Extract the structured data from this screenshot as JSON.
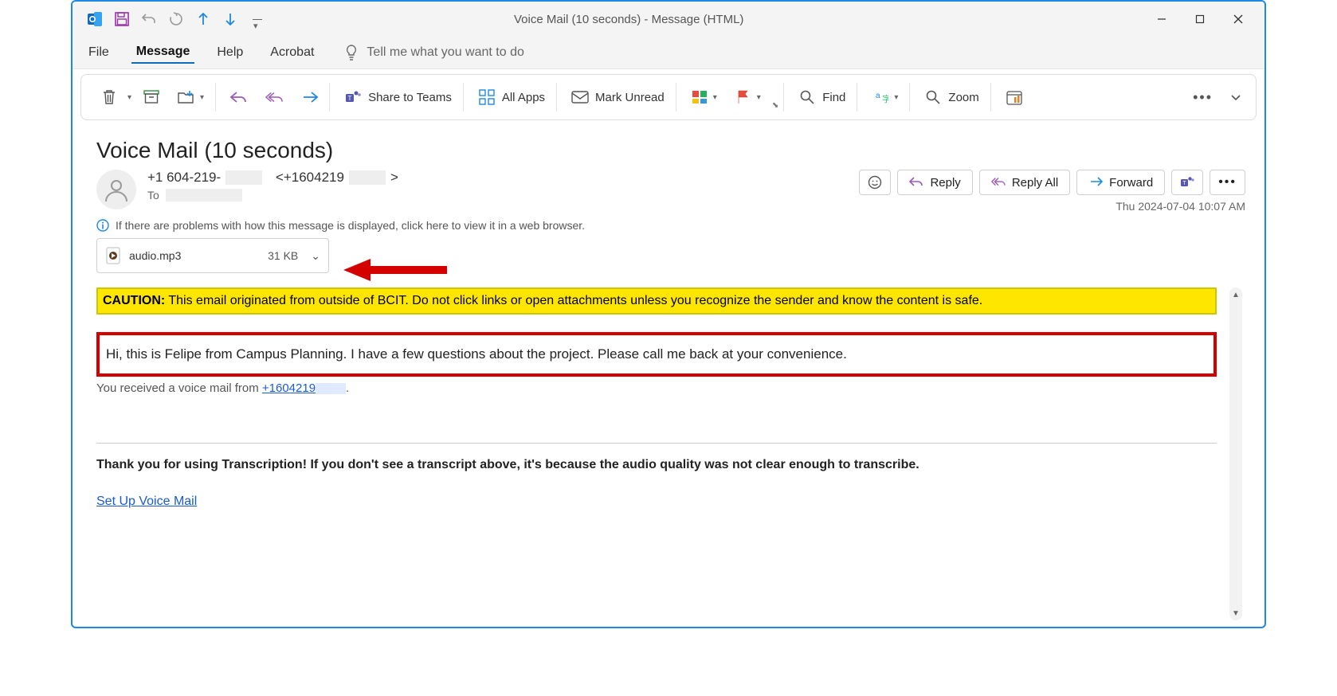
{
  "window": {
    "title": "Voice Mail (10 seconds)  -  Message (HTML)"
  },
  "menu": {
    "file": "File",
    "message": "Message",
    "help": "Help",
    "acrobat": "Acrobat",
    "tellme": "Tell me what you want to do"
  },
  "ribbon": {
    "share_teams": "Share to Teams",
    "all_apps": "All Apps",
    "mark_unread": "Mark Unread",
    "find": "Find",
    "zoom": "Zoom"
  },
  "message": {
    "subject": "Voice Mail (10 seconds)",
    "from_display": "+1 604-219-",
    "from_addr_prefix": "<+1604219",
    "from_addr_suffix": ">",
    "to_label": "To",
    "timestamp": "Thu 2024-07-04 10:07 AM",
    "info_bar": "If there are problems with how this message is displayed, click here to view it in a web browser.",
    "attachment": {
      "name": "audio.mp3",
      "size": "31 KB"
    },
    "actions": {
      "reply": "Reply",
      "reply_all": "Reply All",
      "forward": "Forward"
    }
  },
  "body": {
    "caution_label": "CAUTION:",
    "caution_text": " This email originated from outside of BCIT. Do not click links or open attachments unless you recognize the sender and know the content is safe.",
    "transcript": "Hi, this is Felipe from Campus Planning. I have a few questions about the project. Please call me back at your convenience.",
    "received_prefix": "You received a voice mail from ",
    "received_number": "+1604219",
    "received_suffix": ".",
    "thanks": "Thank you for using Transcription! If you don't see a transcript above, it's because the audio quality was not clear enough to transcribe.",
    "setup_link": "Set Up Voice Mail"
  }
}
